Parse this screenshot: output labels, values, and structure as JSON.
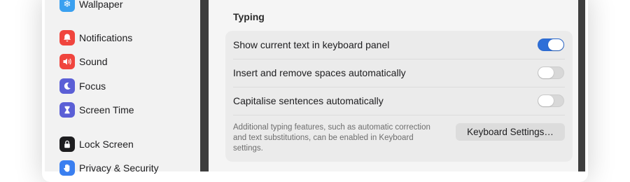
{
  "sidebar": {
    "items": [
      {
        "label": "Wallpaper",
        "icon": "snowflake-icon",
        "color": "#3aa0f0"
      },
      {
        "label": "Notifications",
        "icon": "bell-icon",
        "color": "#f0453e"
      },
      {
        "label": "Sound",
        "icon": "speaker-icon",
        "color": "#f0453e"
      },
      {
        "label": "Focus",
        "icon": "moon-icon",
        "color": "#5b5fd6"
      },
      {
        "label": "Screen Time",
        "icon": "hourglass-icon",
        "color": "#5b5fd6"
      },
      {
        "label": "Lock Screen",
        "icon": "lock-icon",
        "color": "#1d1d1f"
      },
      {
        "label": "Privacy & Security",
        "icon": "hand-icon",
        "color": "#3a7ff0"
      }
    ]
  },
  "main": {
    "section_title": "Typing",
    "rows": [
      {
        "label": "Show current text in keyboard panel",
        "enabled": true
      },
      {
        "label": "Insert and remove spaces automatically",
        "enabled": false
      },
      {
        "label": "Capitalise sentences automatically",
        "enabled": false
      }
    ],
    "footnote": "Additional typing features, such as automatic correction and text substitutions, can be enabled in Keyboard settings.",
    "keyboard_button_label": "Keyboard Settings…"
  },
  "colors": {
    "accent": "#2e6fd8",
    "toggle_off": "#d8d8d8"
  }
}
